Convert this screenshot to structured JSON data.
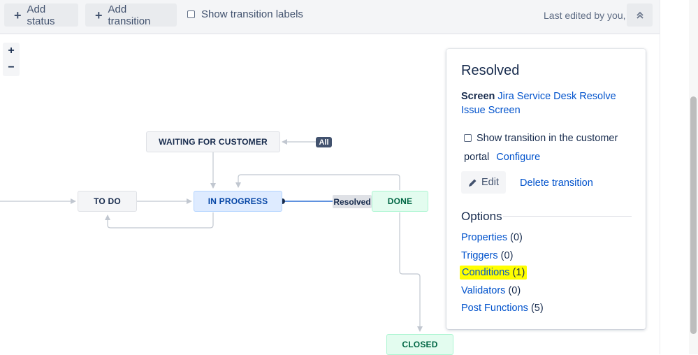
{
  "toolbar": {
    "add_status": "Add status",
    "add_transition": "Add transition",
    "show_transition_labels": "Show transition labels",
    "last_edited": "Last edited by you,",
    "collapse_icon": "double-chevron-up-icon"
  },
  "zoom": {
    "in": "+",
    "out": "−"
  },
  "workflow": {
    "statuses": {
      "waiting": "WAITING FOR CUSTOMER",
      "todo": "TO DO",
      "in_progress": "IN PROGRESS",
      "done": "DONE",
      "closed": "CLOSED"
    },
    "all_badge": "All",
    "transition_label": "Resolved",
    "colors": {
      "grey": "#f4f5f7",
      "blue": "#deebff",
      "green": "#e3fcef",
      "line": "#c1c7d0",
      "selected_line": "#0052cc"
    }
  },
  "panel": {
    "title": "Resolved",
    "screen_label": "Screen",
    "screen_link": "Jira Service Desk Resolve Issue Screen",
    "show_in_portal": "Show transition in the customer portal",
    "configure": "Configure",
    "edit": "Edit",
    "delete": "Delete transition",
    "options_heading": "Options",
    "options": [
      {
        "label": "Properties",
        "count": "(0)"
      },
      {
        "label": "Triggers",
        "count": "(0)"
      },
      {
        "label": "Conditions",
        "count": "(1)",
        "highlighted": true
      },
      {
        "label": "Validators",
        "count": "(0)"
      },
      {
        "label": "Post Functions",
        "count": "(5)"
      }
    ]
  }
}
